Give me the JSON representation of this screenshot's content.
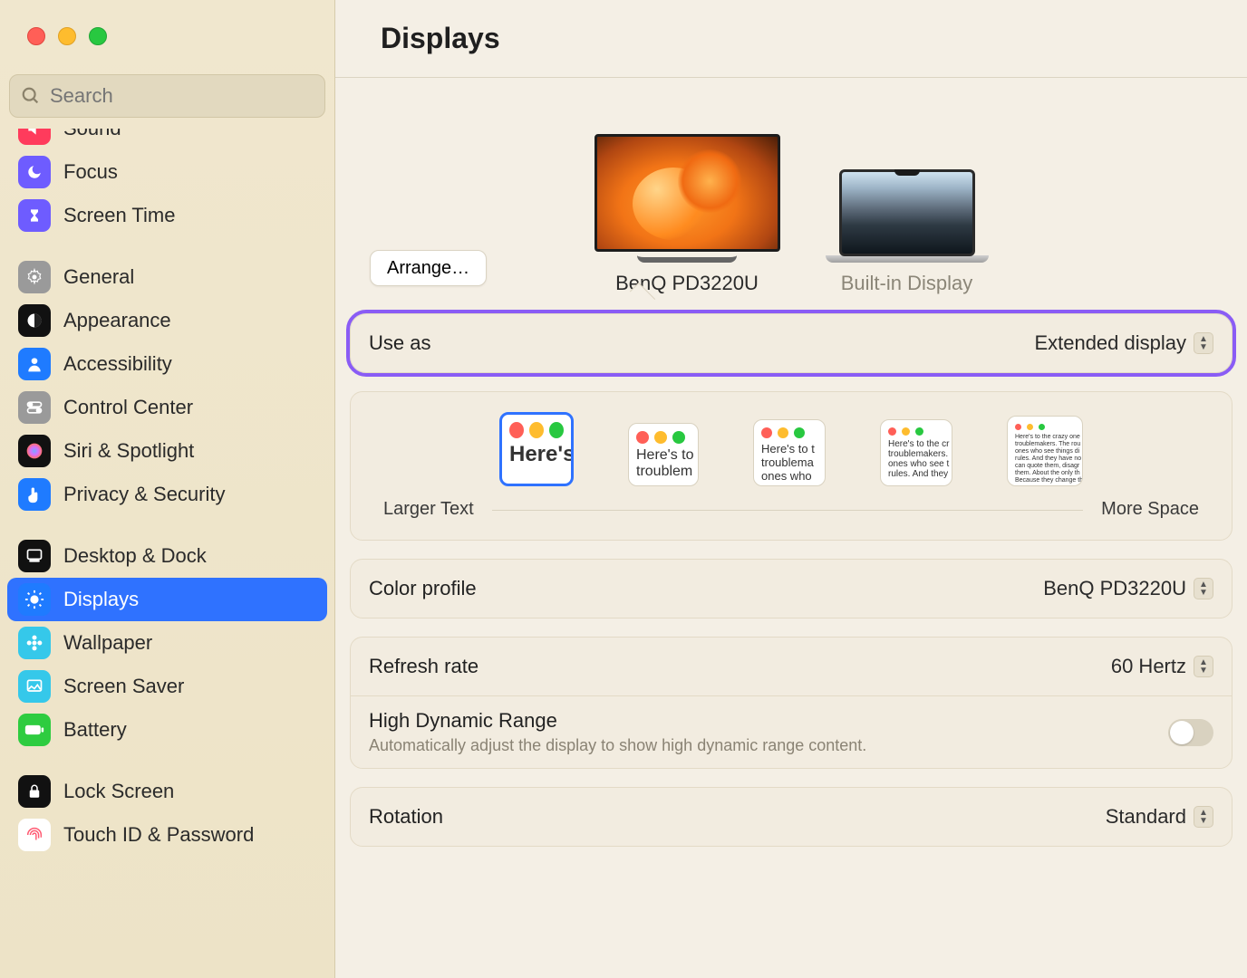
{
  "window": {
    "title": "Displays"
  },
  "search": {
    "placeholder": "Search"
  },
  "sidebar": {
    "top": [
      {
        "label": "Sound",
        "icon": "sound-icon",
        "bg": "#ff3b5c"
      },
      {
        "label": "Focus",
        "icon": "moon-icon",
        "bg": "#6e5cff"
      },
      {
        "label": "Screen Time",
        "icon": "hourglass-icon",
        "bg": "#6e5cff"
      }
    ],
    "mid": [
      {
        "label": "General",
        "icon": "gear-icon",
        "bg": "#9a9a9a"
      },
      {
        "label": "Appearance",
        "icon": "appearance-icon",
        "bg": "#111111"
      },
      {
        "label": "Accessibility",
        "icon": "person-icon",
        "bg": "#1f7bff"
      },
      {
        "label": "Control Center",
        "icon": "switches-icon",
        "bg": "#9a9a9a"
      },
      {
        "label": "Siri & Spotlight",
        "icon": "siri-icon",
        "bg": "#111111"
      },
      {
        "label": "Privacy & Security",
        "icon": "hand-icon",
        "bg": "#1f7bff"
      }
    ],
    "bottom": [
      {
        "label": "Desktop & Dock",
        "icon": "dock-icon",
        "bg": "#111111"
      },
      {
        "label": "Displays",
        "icon": "sun-icon",
        "bg": "#1f7bff",
        "active": true
      },
      {
        "label": "Wallpaper",
        "icon": "flower-icon",
        "bg": "#35c8ea"
      },
      {
        "label": "Screen Saver",
        "icon": "screensv-icon",
        "bg": "#35c8ea"
      },
      {
        "label": "Battery",
        "icon": "battery-icon",
        "bg": "#2ecc40"
      }
    ],
    "tail": [
      {
        "label": "Lock Screen",
        "icon": "lock-icon",
        "bg": "#111111"
      },
      {
        "label": "Touch ID & Password",
        "icon": "fingerprint-icon",
        "bg": "#ffffff",
        "fg": "#ff5a72"
      }
    ]
  },
  "arrange_label": "Arrange…",
  "displays": [
    {
      "name": "BenQ PD3220U",
      "selected": true
    },
    {
      "name": "Built-in Display",
      "selected": false
    }
  ],
  "use_as": {
    "label": "Use as",
    "value": "Extended display"
  },
  "resolution": {
    "left_label": "Larger Text",
    "right_label": "More Space",
    "tiles": [
      {
        "text": "Here's",
        "selected": true
      },
      {
        "text": "Here's to\ntroublem"
      },
      {
        "text": "Here's to t\ntroublema\nones who"
      },
      {
        "text": "Here's to the cr\ntroublemakers.\nones who see t\nrules. And they"
      },
      {
        "text": "Here's to the crazy one\ntroublemakers. The rou\nones who see things di\nrules. And they have no\ncan quote them, disagr\nthem. About the only th\nBecause they change th"
      }
    ]
  },
  "color_profile": {
    "label": "Color profile",
    "value": "BenQ PD3220U"
  },
  "refresh_rate": {
    "label": "Refresh rate",
    "value": "60 Hertz"
  },
  "hdr": {
    "label": "High Dynamic Range",
    "sub": "Automatically adjust the display to show high dynamic range content.",
    "on": false
  },
  "rotation": {
    "label": "Rotation",
    "value": "Standard"
  }
}
